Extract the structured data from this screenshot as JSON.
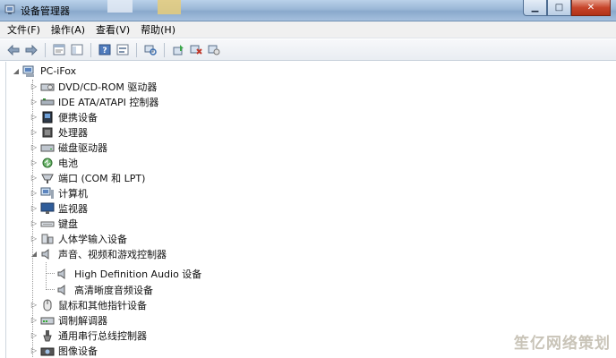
{
  "window": {
    "title": "设备管理器",
    "buttons": {
      "minimize": "▁",
      "maximize": "□",
      "close": "✕"
    }
  },
  "menu": [
    "文件(F)",
    "操作(A)",
    "查看(V)",
    "帮助(H)"
  ],
  "toolbar": {
    "icons": [
      "back-arrow-icon",
      "forward-arrow-icon",
      "properties-icon",
      "show-hide-tree-icon",
      "help-icon",
      "action-list-icon",
      "scan-hardware-icon",
      "update-driver-icon",
      "disable-device-icon",
      "uninstall-device-icon"
    ]
  },
  "tree": {
    "root": "PC-iFox",
    "categories": [
      {
        "label": "DVD/CD-ROM 驱动器",
        "icon": "optical-drive-icon",
        "expanded": false
      },
      {
        "label": "IDE ATA/ATAPI 控制器",
        "icon": "ide-controller-icon",
        "expanded": false
      },
      {
        "label": "便携设备",
        "icon": "portable-device-icon",
        "expanded": false
      },
      {
        "label": "处理器",
        "icon": "processor-icon",
        "expanded": false
      },
      {
        "label": "磁盘驱动器",
        "icon": "disk-drive-icon",
        "expanded": false
      },
      {
        "label": "电池",
        "icon": "battery-icon",
        "expanded": false
      },
      {
        "label": "端口 (COM 和 LPT)",
        "icon": "port-icon",
        "expanded": false
      },
      {
        "label": "计算机",
        "icon": "computer-icon",
        "expanded": false
      },
      {
        "label": "监视器",
        "icon": "monitor-icon",
        "expanded": false
      },
      {
        "label": "键盘",
        "icon": "keyboard-icon",
        "expanded": false
      },
      {
        "label": "人体学输入设备",
        "icon": "hid-icon",
        "expanded": false
      },
      {
        "label": "声音、视频和游戏控制器",
        "icon": "speaker-icon",
        "expanded": true,
        "children": [
          "High Definition Audio 设备",
          "高清晰度音频设备"
        ]
      },
      {
        "label": "鼠标和其他指针设备",
        "icon": "mouse-icon",
        "expanded": false
      },
      {
        "label": "调制解调器",
        "icon": "modem-icon",
        "expanded": false
      },
      {
        "label": "通用串行总线控制器",
        "icon": "usb-icon",
        "expanded": false
      },
      {
        "label": "图像设备",
        "icon": "camera-icon",
        "expanded": false
      }
    ]
  },
  "watermark": "笙亿网络策划"
}
